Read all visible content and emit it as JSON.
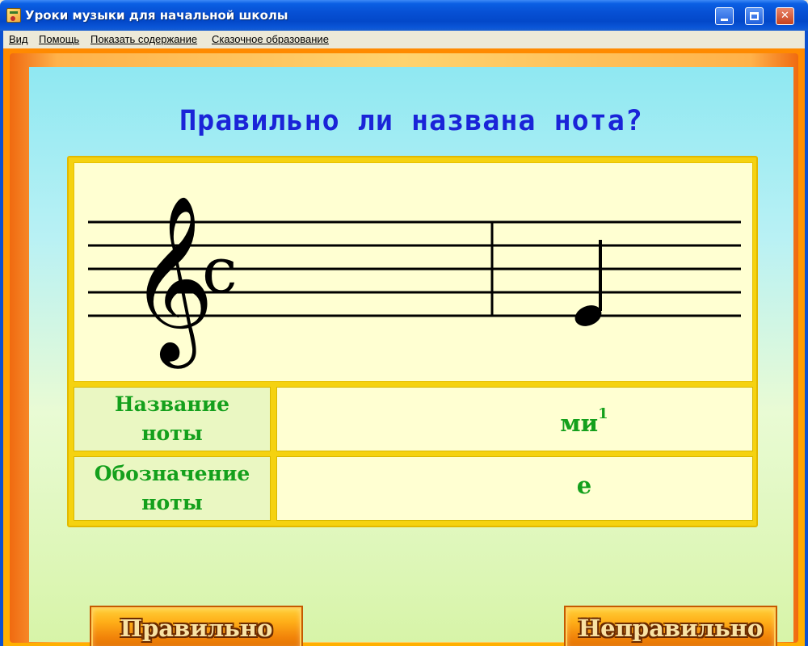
{
  "window": {
    "title": "Уроки музыки для начальной школы",
    "accent_color": "#0a50d0"
  },
  "menu": {
    "items": [
      {
        "label": "Вид"
      },
      {
        "label": "Помощь"
      },
      {
        "label": "Показать содержание"
      },
      {
        "label": "Сказочное образование"
      }
    ]
  },
  "quiz": {
    "question": "Правильно ли названа нота?",
    "clef_icon": "treble-clef-icon",
    "time_signature": "c",
    "note_icon": "quarter-note-icon",
    "rows": [
      {
        "label_line1": "Название",
        "label_line2": "ноты",
        "value": "ми",
        "superscript": "1"
      },
      {
        "label_line1": "Обозначение",
        "label_line2": "ноты",
        "value": "e"
      }
    ],
    "buttons": {
      "correct": "Правильно",
      "incorrect": "Неправильно"
    },
    "colors": {
      "question_text": "#1a24d8",
      "table_text": "#14a01c",
      "panel_border": "#f5d210",
      "button_fill": "#ffae18"
    }
  }
}
